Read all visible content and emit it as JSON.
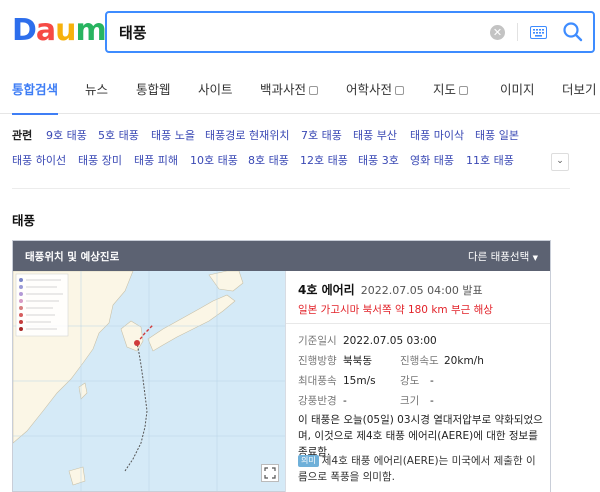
{
  "header": {
    "logo": [
      "D",
      "a",
      "u",
      "m"
    ],
    "logo_colors": [
      "#2d6eec",
      "#f64a45",
      "#f6b10c",
      "#28b460"
    ],
    "search_value": "태풍",
    "accent": "#3e8cff"
  },
  "tabs": [
    {
      "label": "통합검색",
      "active": true,
      "external": false
    },
    {
      "label": "뉴스",
      "active": false,
      "external": false
    },
    {
      "label": "통합웹",
      "active": false,
      "external": false
    },
    {
      "label": "사이트",
      "active": false,
      "external": false
    },
    {
      "label": "백과사전",
      "active": false,
      "external": true
    },
    {
      "label": "어학사전",
      "active": false,
      "external": true
    },
    {
      "label": "지도",
      "active": false,
      "external": true
    },
    {
      "label": "이미지",
      "active": false,
      "external": false
    },
    {
      "label": "더보기",
      "active": false,
      "external": false
    }
  ],
  "related": {
    "title": "관련",
    "row1": [
      "9호 태풍",
      "5호 태풍",
      "태풍 노을",
      "태풍경로 현재위치",
      "7호 태풍",
      "태풍 부산",
      "태풍 마이삭",
      "태풍 일본"
    ],
    "row2": [
      "태풍 하이선",
      "태풍 장미",
      "태풍 피해",
      "10호 태풍",
      "8호 태풍",
      "12호 태풍",
      "태풍 3호",
      "영화 태풍",
      "11호 태풍"
    ]
  },
  "section_title": "태풍",
  "card": {
    "head_title": "태풍위치 및 예상진로",
    "head_select": "다른 태풍선택",
    "name": "4호 에어리",
    "announced": "2022.07.05 04:00 발표",
    "location": "일본 가고시마 북서쪽 약 180 km 부근 해상",
    "base_time_label": "기준일시",
    "base_time": "2022.07.05 03:00",
    "direction_label": "진행방향",
    "direction": "북북동",
    "speed_label": "진행속도",
    "speed": "20km/h",
    "max_wind_label": "최대풍속",
    "max_wind": "15m/s",
    "strength_label": "강도",
    "strength": "-",
    "radius_label": "강풍반경",
    "radius": "-",
    "size_label": "크기",
    "size": "-",
    "description": "이 태풍은 오늘(05일) 03시경 열대저압부로 약화되었으며, 이것으로 제4호 태풍 에어리(AERE)에 대한 정보를 종료함.",
    "note_badge": "의미",
    "note": "제4호 태풍 에어리(AERE)는 미국에서 제출한 이름으로 폭풍을 의미함."
  }
}
